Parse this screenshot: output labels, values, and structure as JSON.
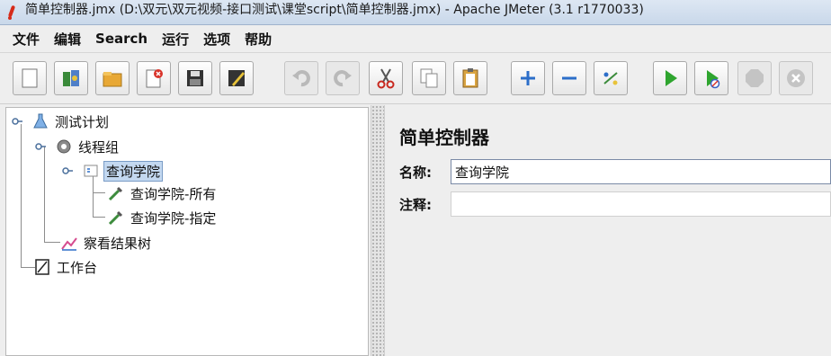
{
  "window": {
    "title": "简单控制器.jmx (D:\\双元\\双元视频-接口测试\\课堂script\\简单控制器.jmx) - Apache JMeter (3.1 r1770033)"
  },
  "menu": {
    "items": [
      "文件",
      "编辑",
      "Search",
      "运行",
      "选项",
      "帮助"
    ]
  },
  "toolbar": {
    "buttons": [
      {
        "icon": "new-file-icon",
        "enabled": true
      },
      {
        "icon": "templates-icon",
        "enabled": true
      },
      {
        "icon": "open-folder-icon",
        "enabled": true
      },
      {
        "icon": "close-file-icon",
        "enabled": true
      },
      {
        "icon": "save-icon",
        "enabled": true
      },
      {
        "icon": "save-as-icon",
        "enabled": true
      },
      {
        "icon": "undo-icon",
        "enabled": false
      },
      {
        "icon": "redo-icon",
        "enabled": false
      },
      {
        "icon": "cut-icon",
        "enabled": true
      },
      {
        "icon": "copy-icon",
        "enabled": true
      },
      {
        "icon": "paste-icon",
        "enabled": true
      },
      {
        "icon": "expand-icon",
        "enabled": true
      },
      {
        "icon": "collapse-icon",
        "enabled": true
      },
      {
        "icon": "toggle-icon",
        "enabled": true
      },
      {
        "icon": "start-icon",
        "enabled": true
      },
      {
        "icon": "start-no-timers-icon",
        "enabled": true
      },
      {
        "icon": "stop-icon",
        "enabled": false
      },
      {
        "icon": "shutdown-icon",
        "enabled": false
      }
    ]
  },
  "tree": {
    "nodes": [
      {
        "label": "测试计划",
        "icon": "test-plan-icon"
      },
      {
        "label": "线程组",
        "icon": "thread-group-icon"
      },
      {
        "label": "查询学院",
        "icon": "simple-controller-icon",
        "selected": true
      },
      {
        "label": "查询学院-所有",
        "icon": "http-sampler-icon"
      },
      {
        "label": "查询学院-指定",
        "icon": "http-sampler-icon"
      },
      {
        "label": "察看结果树",
        "icon": "results-tree-icon"
      },
      {
        "label": "工作台",
        "icon": "workbench-icon"
      }
    ]
  },
  "panel": {
    "title": "简单控制器",
    "name_label": "名称:",
    "name_value": "查询学院",
    "comment_label": "注释:",
    "comment_value": ""
  },
  "colors": {
    "selection": "#c3d8f0",
    "start_green": "#2fa52f"
  }
}
